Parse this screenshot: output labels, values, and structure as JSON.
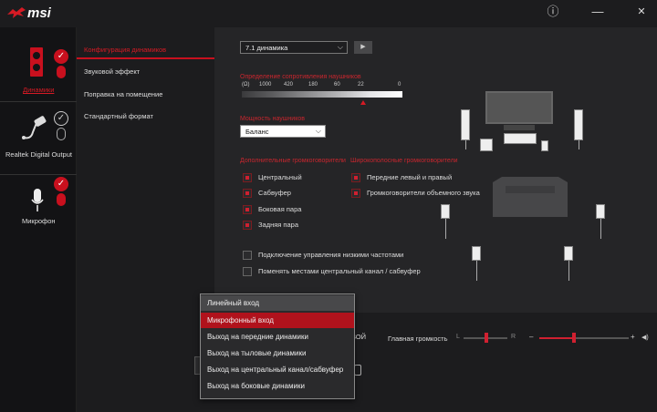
{
  "app": {
    "logo_text": "msi"
  },
  "titlebar": {
    "info": "ⓘ",
    "minimize": "—",
    "close": "✕"
  },
  "devices": [
    {
      "label": "Динамики",
      "active": true
    },
    {
      "label": "Realtek Digital Output",
      "active": false
    },
    {
      "label": "Микрофон",
      "active": false
    }
  ],
  "menu": {
    "items": [
      "Конфигурация динамиков",
      "Звуковой эффект",
      "Поправка на помещение",
      "Стандартный формат"
    ]
  },
  "config": {
    "speaker_select": "7.1 динамика",
    "play_button": "▶",
    "impedance_label": "Определение сопротивления наушников",
    "impedance_ticks": [
      "(Ω)",
      "1000",
      "420",
      "180",
      "60",
      "22",
      "0"
    ],
    "power_label": "Мощность наушников",
    "power_select": "Баланс",
    "extra_label": "Дополнительные громкоговорители",
    "wide_label": "Широкополосные громкоговорители",
    "extra_items": [
      "Центральный",
      "Сабвуфер",
      "Боковая пара",
      "Задняя пара"
    ],
    "wide_items": [
      "Передние левый и правый",
      "Громкоговорители объемного звука"
    ],
    "options": [
      "Подключение управления низкими частотами",
      "Поменять местами центральный канал / сабвуфер"
    ]
  },
  "bottom": {
    "partial_label": "ВОЙ",
    "volume_label": "Главная громкость",
    "l": "L",
    "r": "R",
    "minus": "–",
    "plus": "+",
    "speaker_icon": "◀)"
  },
  "dropdown": {
    "items": [
      "Линейный вход",
      "Микрофонный вход",
      "Выход на передние динамики",
      "Выход на тыловые динамики",
      "Выход на центральный канал/сабвуфер",
      "Выход на боковые динамики"
    ],
    "selected_index": 1
  },
  "colors": {
    "accent": "#c8101e"
  }
}
